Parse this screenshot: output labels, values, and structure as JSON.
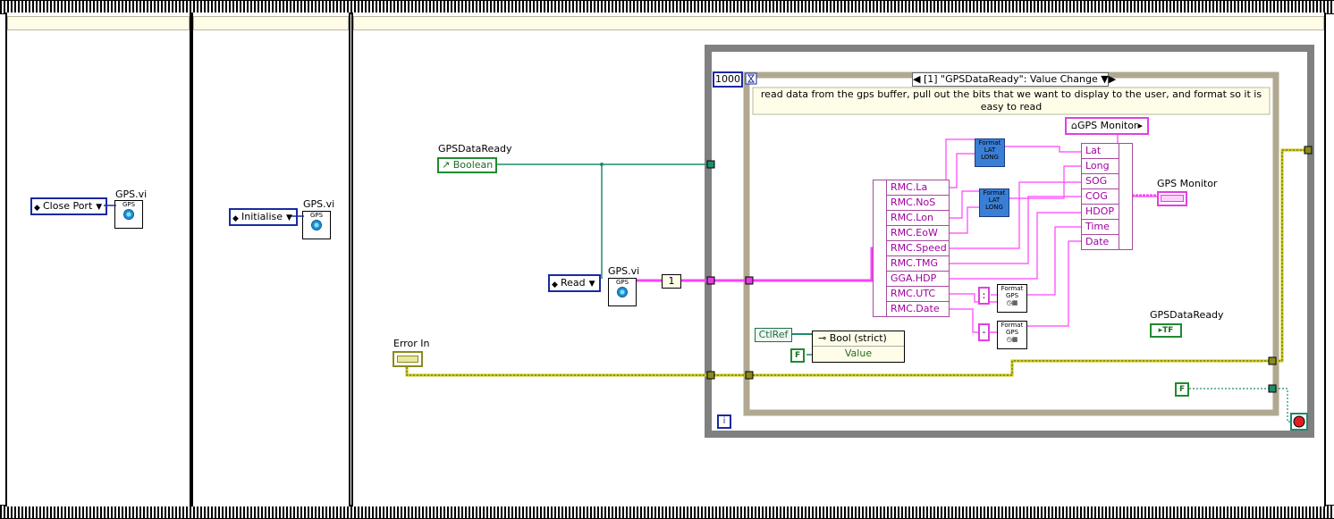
{
  "frames": [
    {
      "id": "frame0"
    },
    {
      "id": "frame1"
    },
    {
      "id": "frame2"
    }
  ],
  "frame0": {
    "enum_label": "Close Port",
    "vi_title": "GPS.vi",
    "vi_icon_text": "GPS"
  },
  "frame1": {
    "enum_label": "Initialise",
    "vi_title": "GPS.vi",
    "vi_icon_text": "GPS"
  },
  "frame2": {
    "gpsdataready_label": "GPSDataReady",
    "boolean_label": "Boolean",
    "read_enum": "Read",
    "vi_title": "GPS.vi",
    "vi_icon_text": "GPS",
    "index_const": "1",
    "error_in_label": "Error In",
    "timeout_const": "1000",
    "iteration_label": "i"
  },
  "event": {
    "selector": "[1] \"GPSDataReady\": Value Change",
    "comment": "read data from the gps buffer, pull out the bits that we want to display to the user,  and format so it is easy to read",
    "unbundle_items": [
      "RMC.La",
      "RMC.NoS",
      "RMC.Lon",
      "RMC.EoW",
      "RMC.Speed",
      "RMC.TMG",
      "GGA.HDP",
      "RMC.UTC",
      "RMC.Date"
    ],
    "bundle_items": [
      "Lat",
      "Long",
      "SOG",
      "COG",
      "HDOP",
      "Time",
      "Date"
    ],
    "gps_monitor_node": "GPS Monitor",
    "gps_monitor_label": "GPS Monitor",
    "format_latlong_1": "Format LAT LONG",
    "format_latlong_2": "Format LAT LONG",
    "format_gps_1": "Format GPS",
    "format_gps_2": "Format GPS",
    "colon_const": ":",
    "dash_const": "-",
    "ctlref_label": "CtlRef",
    "property_name": "Bool (strict)",
    "property_value": "Value",
    "false_const": "F",
    "gpsdataready_local_label": "GPSDataReady",
    "tf_label": "TF"
  },
  "loop": {
    "false_const": "F"
  },
  "colors": {
    "wire_pink": "#ff40ff",
    "wire_green": "#1f8b6f",
    "wire_error": "#c8c800",
    "border_blue": "#1a2aa0"
  }
}
